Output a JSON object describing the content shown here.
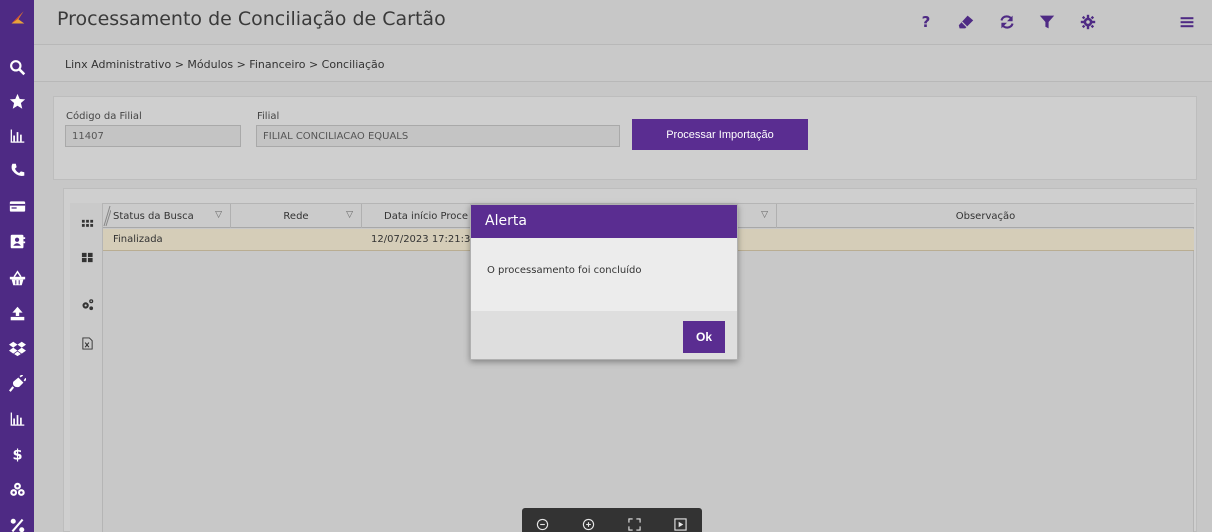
{
  "app": {
    "title": "Processamento de Conciliação de Cartão"
  },
  "breadcrumb": {
    "text": "Linx Administrativo > Módulos > Financeiro > Conciliação"
  },
  "toolbar": {
    "help_label": "?"
  },
  "filters": {
    "branch_code_label": "Código da Filial",
    "branch_code_value": "11407",
    "branch_label": "Filial",
    "branch_value": "FILIAL CONCILIACAO EQUALS",
    "process_button": "Processar Importação"
  },
  "grid": {
    "columns": [
      {
        "label": "Status da Busca"
      },
      {
        "label": "Rede"
      },
      {
        "label": "Data início Proce"
      },
      {
        "label": "Observação"
      }
    ],
    "rows": [
      {
        "status": "Finalizada",
        "rede": "",
        "data_inicio": "12/07/2023 17:21:3",
        "observacao": ""
      }
    ]
  },
  "modal": {
    "title": "Alerta",
    "message": "O processamento foi concluído",
    "ok_label": "Ok"
  },
  "colors": {
    "brand": "#4e2a84",
    "accent": "#5a2d91",
    "row_highlight": "#d5cdb8"
  },
  "icons": {
    "rail": [
      "linx-logo-icon",
      "search-icon",
      "star-icon",
      "bar-chart-icon",
      "phone-icon",
      "card-icon",
      "contact-icon",
      "basket-icon",
      "upload-icon",
      "dropbox-icon",
      "plug-icon",
      "bar-chart-2-icon",
      "dollar-icon",
      "coins-icon",
      "percent-icon"
    ]
  }
}
